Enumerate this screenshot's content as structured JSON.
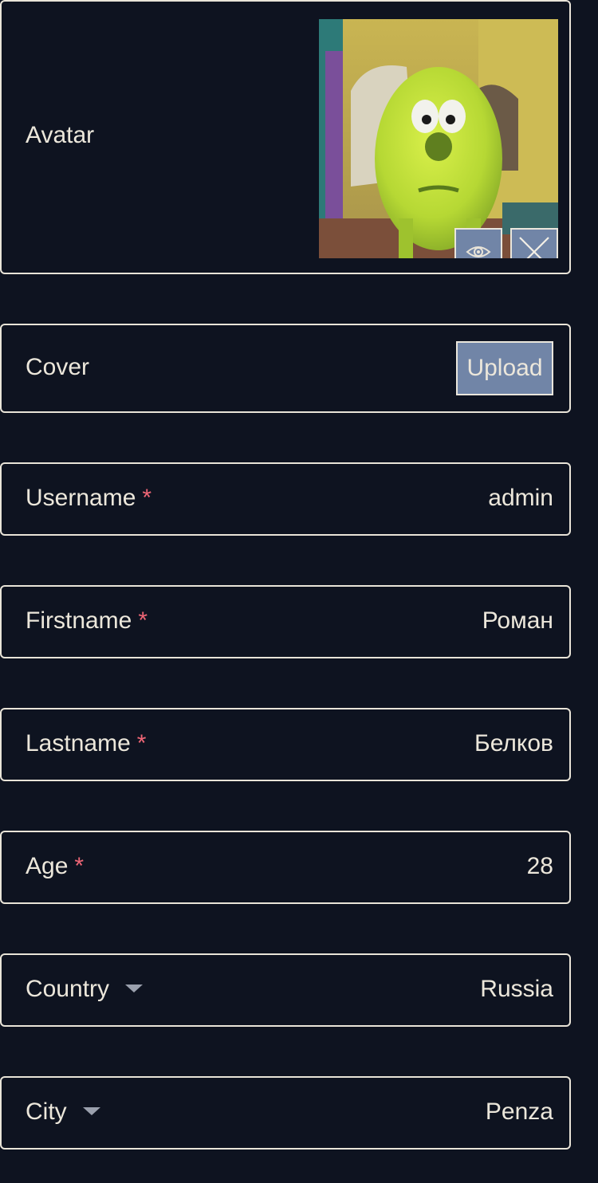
{
  "avatar": {
    "label": "Avatar",
    "image_alt": "Monster with green round face",
    "preview_icon": "eye-icon",
    "remove_icon": "close-icon"
  },
  "cover": {
    "label": "Cover",
    "upload_label": "Upload"
  },
  "fields": [
    {
      "label": "Username",
      "required_mark": "*",
      "value": "admin"
    },
    {
      "label": "Firstname",
      "required_mark": "*",
      "value": "Роман"
    },
    {
      "label": "Lastname",
      "required_mark": "*",
      "value": "Белков"
    },
    {
      "label": "Age",
      "required_mark": "*",
      "value": "28"
    }
  ],
  "selects": [
    {
      "label": "Country",
      "value": "Russia",
      "icon": "caret-down-icon"
    },
    {
      "label": "City",
      "value": "Penza",
      "icon": "caret-down-icon"
    }
  ],
  "colors": {
    "background": "#0e1320",
    "border": "#e9e4d8",
    "button": "#7185a7",
    "required": "#ef6676",
    "text": "#ece7db"
  }
}
